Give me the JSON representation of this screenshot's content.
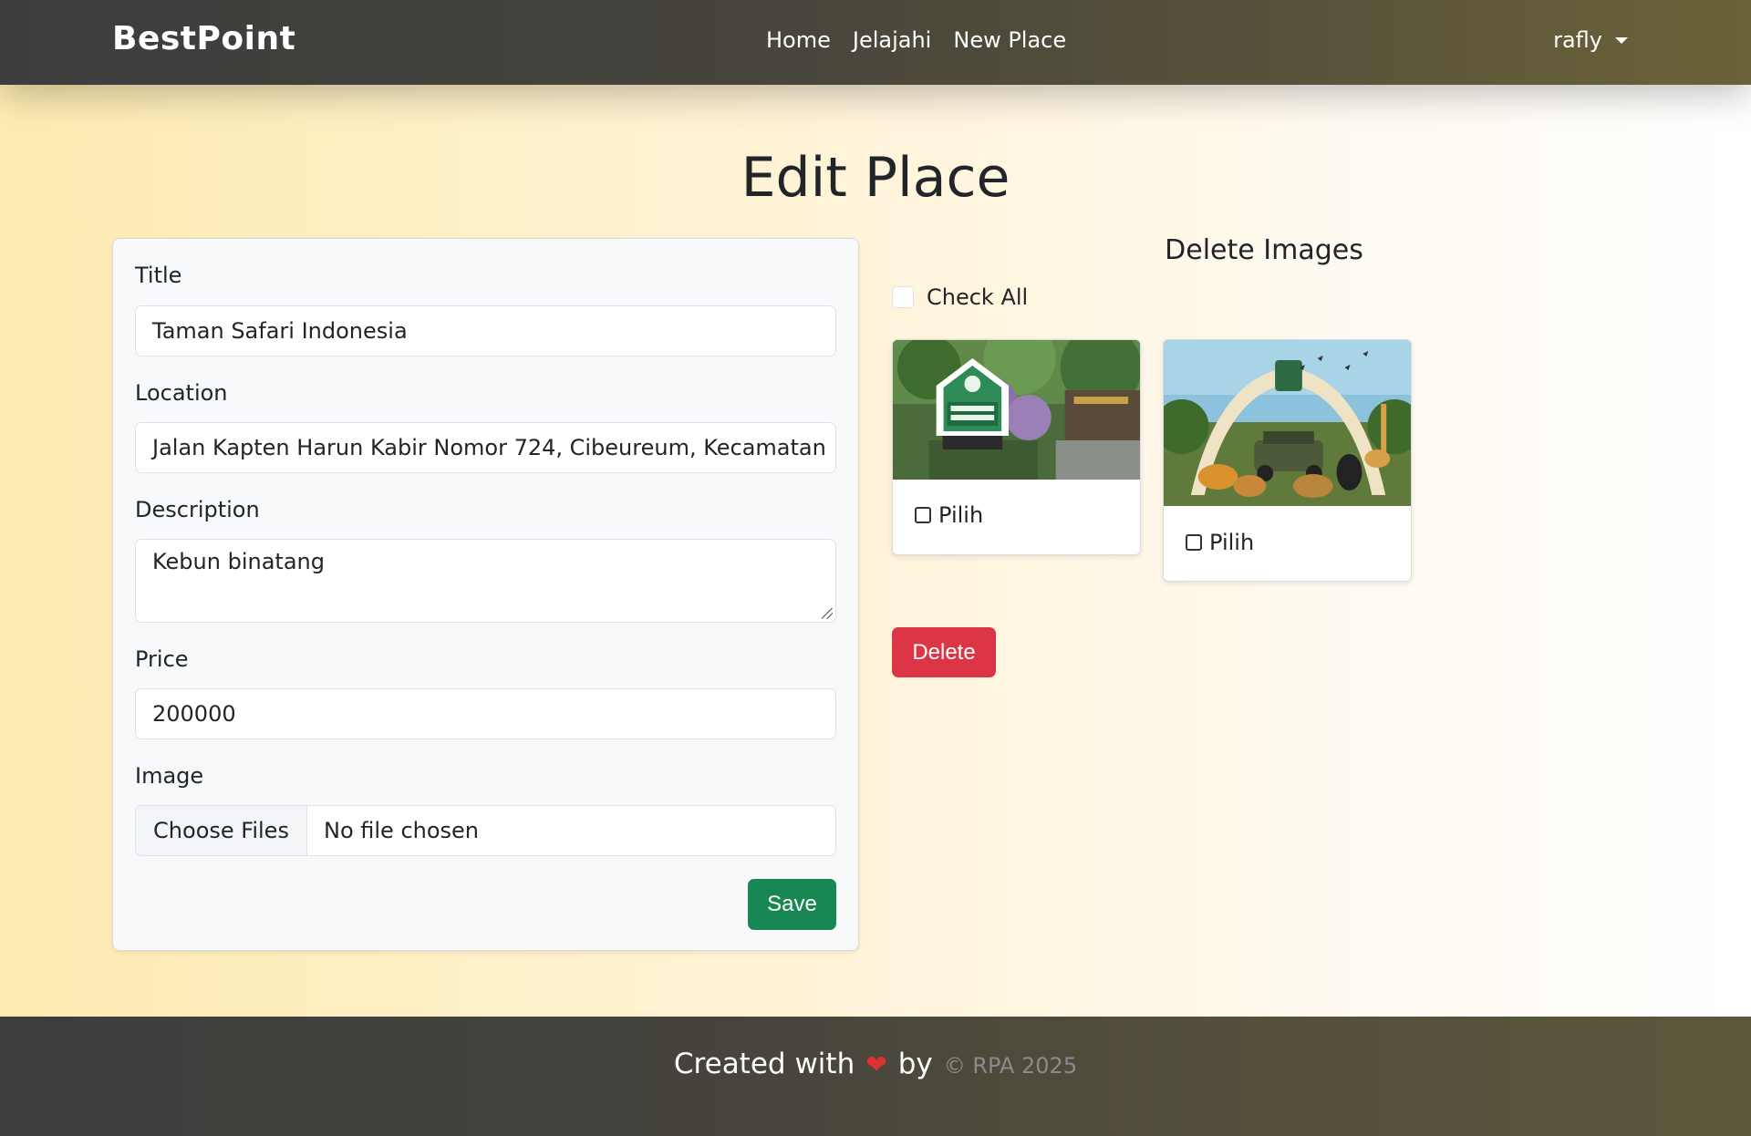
{
  "nav": {
    "brand": "BestPoint",
    "links": [
      "Home",
      "Jelajahi",
      "New Place"
    ],
    "user": "rafly"
  },
  "page": {
    "title": "Edit Place"
  },
  "form": {
    "title_label": "Title",
    "title_value": "Taman Safari Indonesia",
    "location_label": "Location",
    "location_value": "Jalan Kapten Harun Kabir Nomor 724, Cibeureum, Kecamatan",
    "description_label": "Description",
    "description_value": "Kebun binatang",
    "price_label": "Price",
    "price_value": "200000",
    "image_label": "Image",
    "file_button": "Choose Files",
    "file_status": "No file chosen",
    "save_label": "Save"
  },
  "delete_panel": {
    "title": "Delete Images",
    "check_all_label": "Check All",
    "images": [
      {
        "label": "Pilih",
        "icon": "taman-safari-entrance-photo"
      },
      {
        "label": "Pilih",
        "icon": "taman-safari-arch-animals-photo"
      }
    ],
    "delete_label": "Delete"
  },
  "footer": {
    "created_with": "Created with",
    "heart": "❤",
    "by": "by",
    "copyright": "© RPA 2025"
  },
  "colors": {
    "save_button": "#198754",
    "delete_button": "#dc3545",
    "heart": "#e03131"
  }
}
